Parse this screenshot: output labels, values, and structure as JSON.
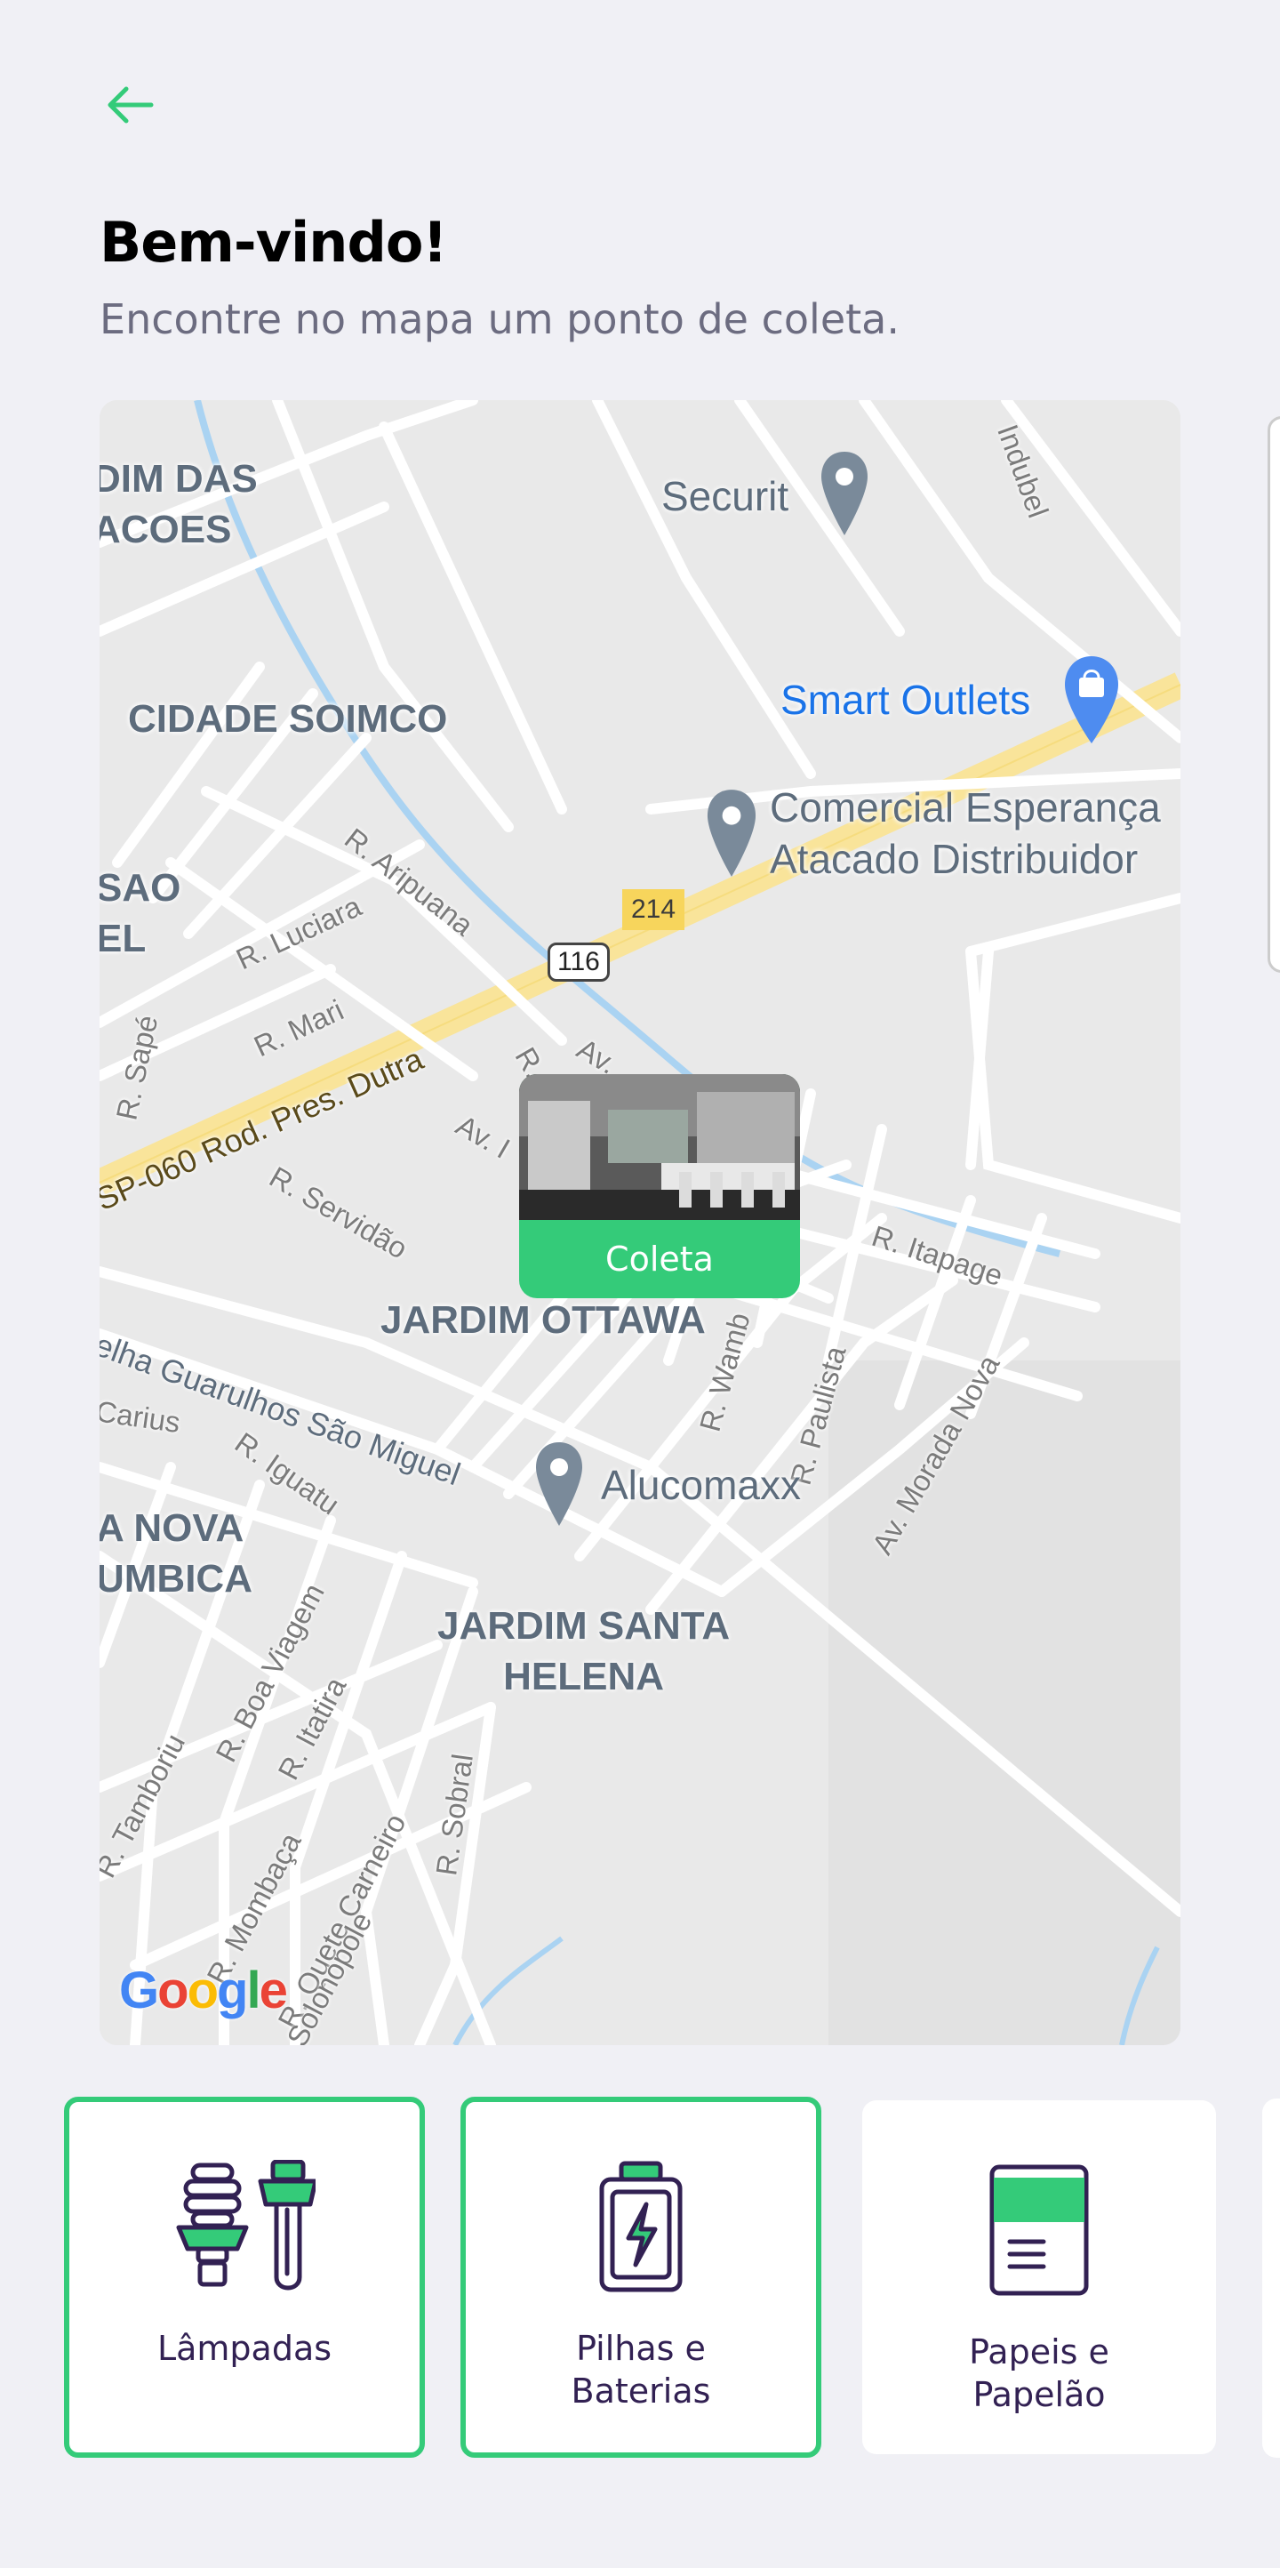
{
  "header": {
    "back_icon": "arrow-left-icon",
    "title": "Bem-vindo!",
    "subtitle": "Encontre no mapa um ponto de coleta."
  },
  "map": {
    "areas": [
      "DIM DAS\nACOES",
      "CIDADE SOIMCO",
      "SAO\nEL",
      "JARDIM OTTAWA",
      "A NOVA\nUMBICA",
      "JARDIM SANTA\nHELENA"
    ],
    "streets": [
      "R. Aripuana",
      "R. Luciara",
      "R. Mari",
      "R. Sapé",
      "SP-060 Rod. Pres. Dutra",
      "R. Servidão",
      "Av. I",
      "R.",
      "Av.",
      "R. Itapage",
      "R. Wamb",
      "R. Paulista",
      "Av. Morada Nova",
      "elha Guarulhos São Miguel",
      "Carius",
      "R. Iguatu",
      "R. Boa Viagem",
      "R. Itatira",
      "R. Tamboriu",
      "R. Mombaça",
      "R. Sobral",
      "R. Quete Carneiro",
      "Solonopole",
      "Indubel"
    ],
    "pois": {
      "securit": "Securit",
      "smart_outlets": "Smart Outlets",
      "comercial": "Comercial Esperança\nAtacado Distribuidor",
      "alucomaxx": "Alucomaxx"
    },
    "shields": {
      "br": "116",
      "route": "214"
    },
    "marker_label": "Coleta",
    "attribution": "Google"
  },
  "items": [
    {
      "label": "Lâmpadas",
      "icon": "lamp-icon",
      "selected": true
    },
    {
      "label": "Pilhas e\nBaterias",
      "icon": "battery-icon",
      "selected": true
    },
    {
      "label": "Papeis e\nPapelão",
      "icon": "paper-icon",
      "selected": false
    }
  ],
  "colors": {
    "accent": "#34CB79",
    "text_dark": "#322153",
    "text_muted": "#6C6C80",
    "background": "#F0F0F5"
  }
}
